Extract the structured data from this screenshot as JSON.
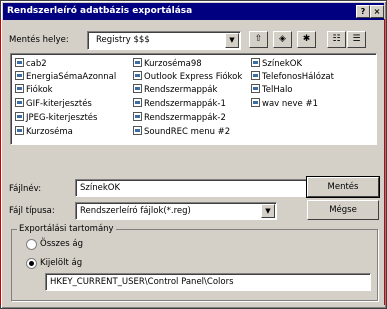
{
  "window": {
    "title": "Rendszerleíró adatbázis exportálása",
    "help_btn": "?",
    "close_btn": "×"
  },
  "save_in": {
    "label": "Mentés helye:",
    "value": "Registry $$$"
  },
  "toolbar": {
    "up_icon": "up-folder-icon",
    "desktop_icon": "desktop-icon",
    "newfolder_icon": "new-folder-icon",
    "list_icon": "list-view-icon",
    "details_icon": "details-view-icon"
  },
  "files": [
    "cab2",
    "EnergiaSémaAzonnal",
    "Fiókok",
    "GIF-kiterjesztés",
    "JPEG-kiterjesztés",
    "Kurzoséma",
    "Kurzoséma98",
    "Outlook Express Fiókok",
    "Rendszermappák",
    "Rendszermappák-1",
    "Rendszermappák-2",
    "SoundREC menu #2",
    "SzínekOK",
    "TelefonosHálózat",
    "TelHalo",
    "wav neve #1"
  ],
  "filename": {
    "label": "Fájlnév:",
    "value": "SzínekOK"
  },
  "filetype": {
    "label": "Fájl típusa:",
    "value": "Rendszerleíró fájlok(*.reg)"
  },
  "buttons": {
    "save": "Mentés",
    "cancel": "Mégse"
  },
  "export_range": {
    "title": "Exportálási tartomány",
    "all_label": "Összes ág",
    "selected_label": "Kijelölt ág",
    "selected_value": "HKEY_CURRENT_USER\\Control Panel\\Colors"
  }
}
